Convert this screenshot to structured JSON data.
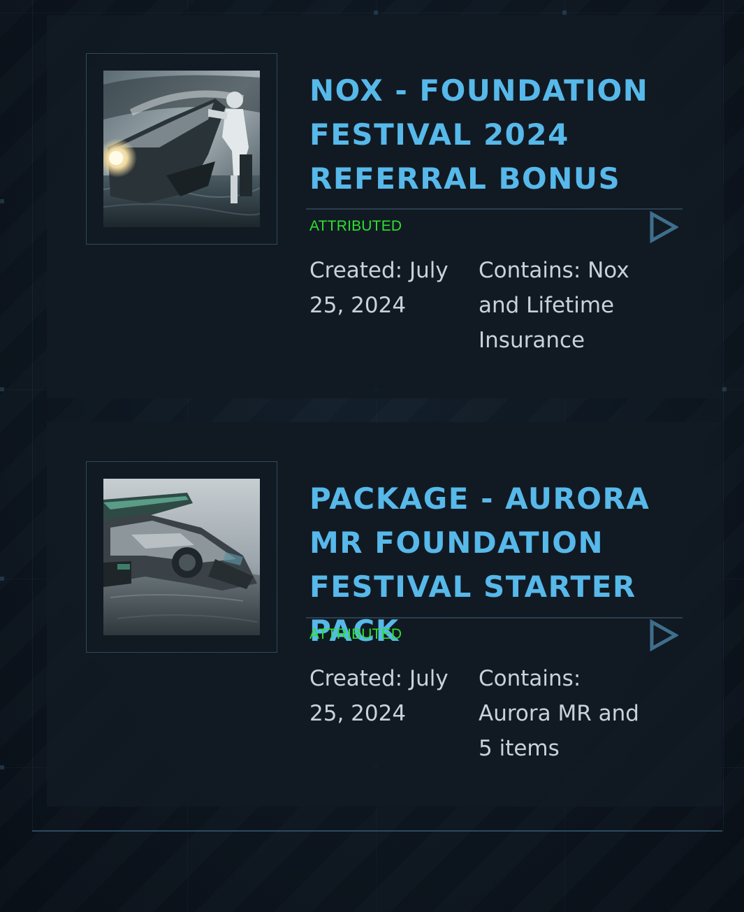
{
  "pledges": [
    {
      "title": "NOX - FOUNDATION FESTIVAL 2024 REFERRAL BONUS",
      "status": "ATTRIBUTED",
      "created": "Created: July 25, 2024",
      "contains": "Contains: Nox and Lifetime Insurance",
      "thumbnail_icon": "nox-hoverbike-image"
    },
    {
      "title": "PACKAGE - AURORA MR FOUNDATION FESTIVAL STARTER PACK",
      "status": "ATTRIBUTED",
      "created": "Created: July 25, 2024",
      "contains": "Contains: Aurora MR and 5 items",
      "thumbnail_icon": "aurora-mr-ship-image"
    }
  ],
  "colors": {
    "title": "#57b8ea",
    "status": "#2fe02f",
    "meta_text": "#c9d2d9",
    "card_bg": "#111a23",
    "frame_border": "#2b4a5e",
    "play_icon": "#3e6f8c"
  }
}
